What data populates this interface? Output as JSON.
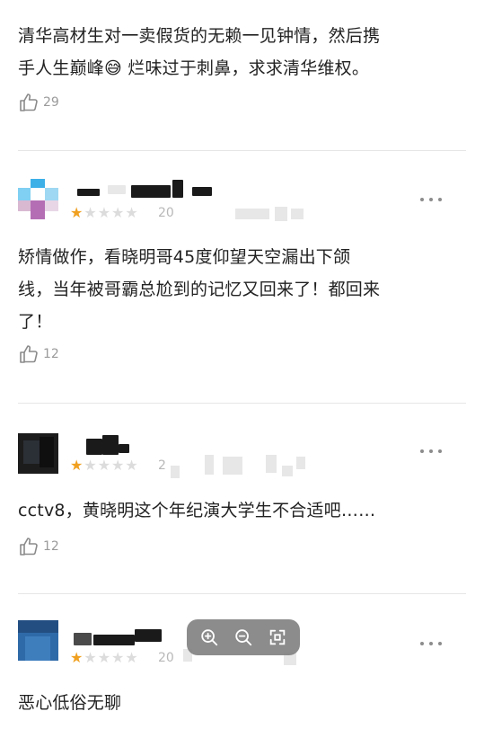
{
  "comments": [
    {
      "text_lines": [
        "清华高材生对一卖假货的无赖一见钟情，然后携",
        "手人生巅峰😅 烂味过于刺鼻，求求清华维权。"
      ],
      "likes": "29"
    },
    {
      "date_partial": "20",
      "rating": 1,
      "text_lines": [
        "矫情做作，看晓明哥45度仰望天空漏出下颌",
        "线，当年被哥霸总尬到的记忆又回来了！都回来",
        "了！"
      ],
      "likes": "12"
    },
    {
      "date_partial": "2",
      "rating": 1,
      "text_lines": [
        "cctv8，黄晓明这个年纪演大学生不合适吧……"
      ],
      "likes": "12"
    },
    {
      "date_partial": "20",
      "rating": 1,
      "text_lines": [
        "恶心低俗无聊"
      ]
    }
  ],
  "icons": {
    "like": "thumbs-up-icon",
    "more": "more-dots-icon",
    "zoom_in": "zoom-in-icon",
    "zoom_out": "zoom-out-icon",
    "fit": "fit-screen-icon"
  },
  "colors": {
    "star_on": "#f0a020",
    "star_off": "#dcdcdc",
    "muted": "#9a9a9a",
    "zoom_bar": "#828282"
  }
}
